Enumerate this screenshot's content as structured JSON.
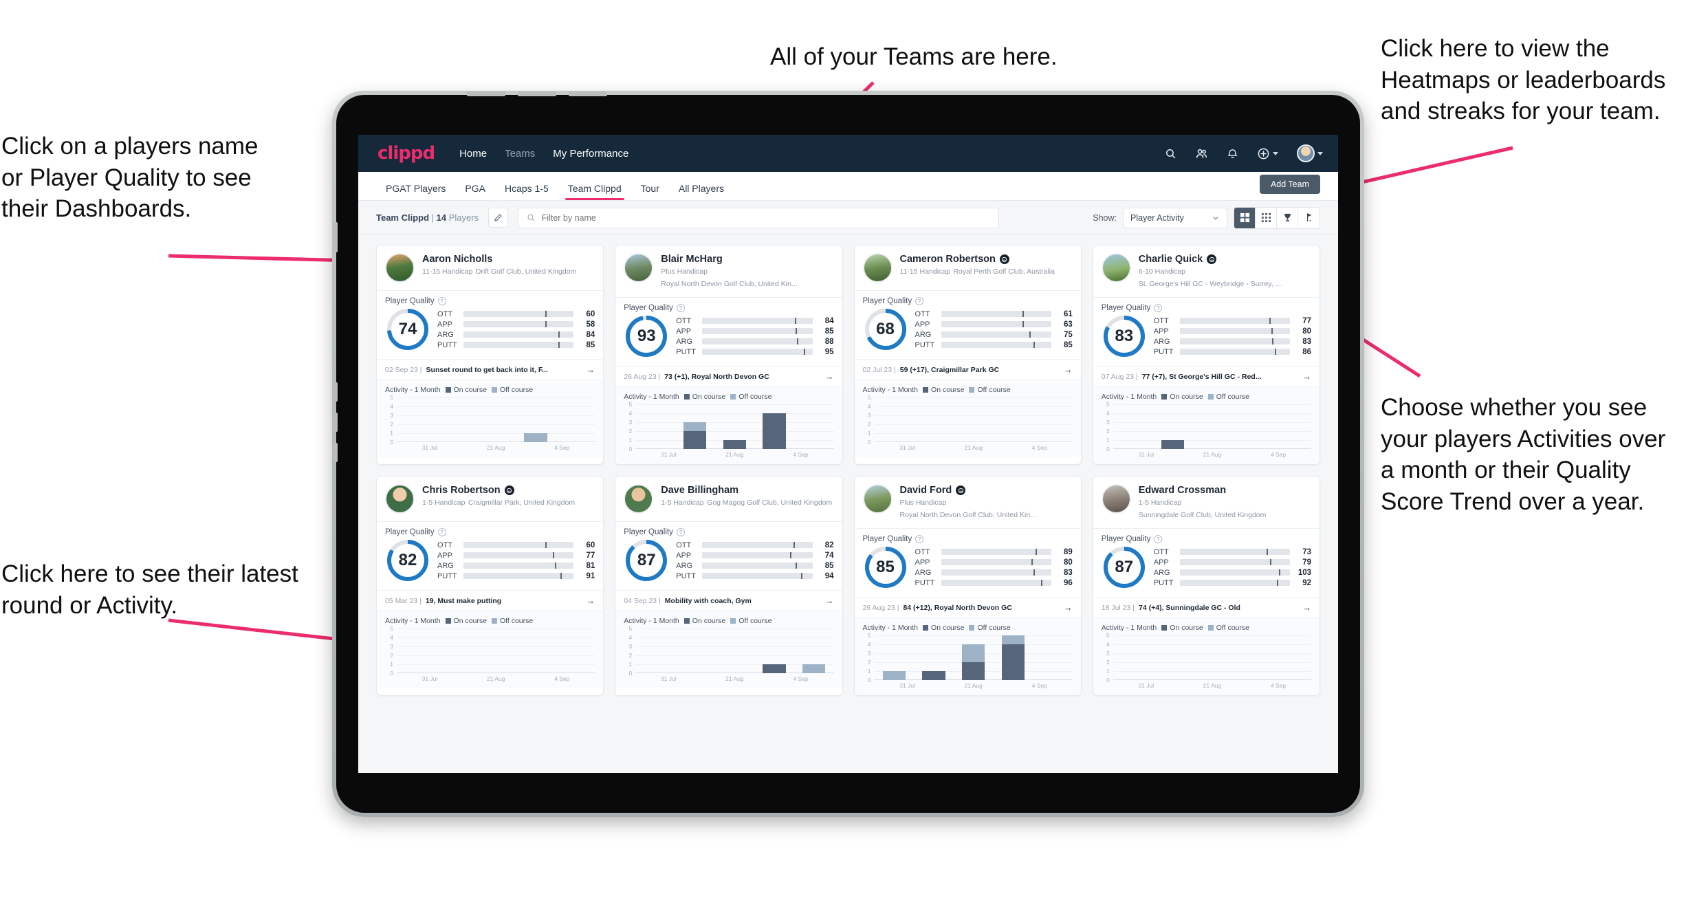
{
  "annotations": {
    "left_top": "Click on a players name\nor Player Quality to see\ntheir Dashboards.",
    "left_bottom": "Click here to see their latest\nround or Activity.",
    "top": "All of your Teams are here.",
    "right_top": "Click here to view the\nHeatmaps or leaderboards\nand streaks for your team.",
    "right_bottom": "Choose whether you see\nyour players Activities over\na month or their Quality\nScore Trend over a year."
  },
  "colors": {
    "brand_pink": "#ec2d6b",
    "navbar": "#15293b",
    "ott": "#f5a800",
    "app": "#3ad7b0",
    "arg": "#f4136b",
    "putt": "#b014c4",
    "donut": "#1e7ac4",
    "on_course": "#56657a",
    "off_course": "#9db2c6"
  },
  "navbar": {
    "logo": "clippd",
    "links": [
      {
        "label": "Home",
        "active": true
      },
      {
        "label": "Teams",
        "active": false
      },
      {
        "label": "My Performance",
        "active": true
      }
    ],
    "icons": [
      "search-icon",
      "people-icon",
      "bell-icon",
      "plus-circle-icon",
      "avatar"
    ]
  },
  "tabs": [
    {
      "label": "PGAT Players",
      "active": false
    },
    {
      "label": "PGA",
      "active": false
    },
    {
      "label": "Hcaps 1-5",
      "active": false
    },
    {
      "label": "Team Clippd",
      "active": true
    },
    {
      "label": "Tour",
      "active": false
    },
    {
      "label": "All Players",
      "active": false
    }
  ],
  "add_team_label": "Add Team",
  "toolbar": {
    "team_name": "Team Clippd",
    "team_separator": " | ",
    "team_count": "14",
    "team_count_suffix": " Players",
    "edit_icon": "pencil-icon",
    "search_placeholder": "Filter by name",
    "show_label": "Show:",
    "show_value": "Player Activity",
    "show_options": [
      "Player Activity",
      "Quality Score Trend"
    ],
    "view_toggles": [
      {
        "name": "grid-large-icon",
        "active": true
      },
      {
        "name": "grid-small-icon",
        "active": false
      },
      {
        "name": "trophy-icon",
        "active": false
      },
      {
        "name": "golf-flag-icon",
        "active": false
      }
    ]
  },
  "card_labels": {
    "player_quality": "Player Quality",
    "activity_title": "Activity - 1 Month",
    "legend_on": "On course",
    "legend_off": "Off course",
    "metric_names": [
      "OTT",
      "APP",
      "ARG",
      "PUTT"
    ]
  },
  "chart_data": {
    "type": "bar",
    "title": "Activity - 1 Month",
    "categories": [
      "31 Jul",
      "",
      "21 Aug",
      "4 Sep"
    ],
    "xlabels": [
      "31 Jul",
      "21 Aug",
      "4 Sep"
    ],
    "ylim": [
      0,
      5
    ],
    "yticks": [
      0,
      1,
      2,
      3,
      4,
      5
    ],
    "ylabel": "",
    "xlabel": "",
    "grid": true,
    "legend": [
      "On course",
      "Off course"
    ],
    "stacked": true,
    "series_per_player": true
  },
  "players": [
    {
      "name": "Aaron Nicholls",
      "verified": false,
      "handicap": "11-15 Handicap",
      "club": "Drift Golf Club, United Kingdom",
      "score": "74",
      "score_pct": 74,
      "metrics": [
        {
          "label": "OTT",
          "value": "60",
          "pct": 56,
          "tick": 74
        },
        {
          "label": "APP",
          "value": "58",
          "pct": 54,
          "tick": 74
        },
        {
          "label": "ARG",
          "value": "84",
          "pct": 79,
          "tick": 86
        },
        {
          "label": "PUTT",
          "value": "85",
          "pct": 80,
          "tick": 86
        }
      ],
      "round_date": "02 Sep 23",
      "round_text": "Sunset round to get back into it, F...",
      "activity": [
        {
          "on": 0,
          "off": 0
        },
        {
          "on": 0,
          "off": 0
        },
        {
          "on": 0,
          "off": 0
        },
        {
          "on": 0,
          "off": 1
        },
        {
          "on": 0,
          "off": 0
        }
      ]
    },
    {
      "name": "Blair McHarg",
      "verified": false,
      "handicap": "Plus Handicap",
      "club": "Royal North Devon Golf Club, United Kin...",
      "score": "93",
      "score_pct": 97,
      "metrics": [
        {
          "label": "OTT",
          "value": "84",
          "pct": 77,
          "tick": 84
        },
        {
          "label": "APP",
          "value": "85",
          "pct": 78,
          "tick": 85
        },
        {
          "label": "ARG",
          "value": "88",
          "pct": 80,
          "tick": 86
        },
        {
          "label": "PUTT",
          "value": "95",
          "pct": 88,
          "tick": 92
        }
      ],
      "round_date": "26 Aug 23",
      "round_text": "73 (+1), Royal North Devon GC",
      "activity": [
        {
          "on": 0,
          "off": 0
        },
        {
          "on": 2,
          "off": 1
        },
        {
          "on": 1,
          "off": 0
        },
        {
          "on": 4,
          "off": 0
        },
        {
          "on": 0,
          "off": 0
        }
      ]
    },
    {
      "name": "Cameron Robertson",
      "verified": true,
      "handicap": "11-15 Handicap",
      "club": "Royal Perth Golf Club, Australia",
      "score": "68",
      "score_pct": 68,
      "metrics": [
        {
          "label": "OTT",
          "value": "61",
          "pct": 56,
          "tick": 74
        },
        {
          "label": "APP",
          "value": "63",
          "pct": 54,
          "tick": 74
        },
        {
          "label": "ARG",
          "value": "75",
          "pct": 70,
          "tick": 80
        },
        {
          "label": "PUTT",
          "value": "85",
          "pct": 77,
          "tick": 84
        }
      ],
      "round_date": "02 Jul 23",
      "round_text": "59 (+17), Craigmillar Park GC",
      "activity": [
        {
          "on": 0,
          "off": 0
        },
        {
          "on": 0,
          "off": 0
        },
        {
          "on": 0,
          "off": 0
        },
        {
          "on": 0,
          "off": 0
        },
        {
          "on": 0,
          "off": 0
        }
      ]
    },
    {
      "name": "Charlie Quick",
      "verified": true,
      "handicap": "6-10 Handicap",
      "club": "St. George's Hill GC - Weybridge - Surrey, ...",
      "score": "83",
      "score_pct": 83,
      "metrics": [
        {
          "label": "OTT",
          "value": "77",
          "pct": 72,
          "tick": 81
        },
        {
          "label": "APP",
          "value": "80",
          "pct": 75,
          "tick": 83
        },
        {
          "label": "ARG",
          "value": "83",
          "pct": 77,
          "tick": 84
        },
        {
          "label": "PUTT",
          "value": "86",
          "pct": 79,
          "tick": 86
        }
      ],
      "round_date": "07 Aug 23",
      "round_text": "77 (+7), St George's Hill GC - Red...",
      "activity": [
        {
          "on": 0,
          "off": 0
        },
        {
          "on": 1,
          "off": 0
        },
        {
          "on": 0,
          "off": 0
        },
        {
          "on": 0,
          "off": 0
        },
        {
          "on": 0,
          "off": 0
        }
      ]
    },
    {
      "name": "Chris Robertson",
      "verified": true,
      "handicap": "1-5 Handicap",
      "club": "Craigmillar Park, United Kingdom",
      "score": "82",
      "score_pct": 84,
      "metrics": [
        {
          "label": "OTT",
          "value": "60",
          "pct": 56,
          "tick": 74
        },
        {
          "label": "APP",
          "value": "77",
          "pct": 72,
          "tick": 81
        },
        {
          "label": "ARG",
          "value": "81",
          "pct": 75,
          "tick": 83
        },
        {
          "label": "PUTT",
          "value": "91",
          "pct": 84,
          "tick": 88
        }
      ],
      "round_date": "05 Mar 23",
      "round_text": "19, Must make putting",
      "activity": [
        {
          "on": 0,
          "off": 0
        },
        {
          "on": 0,
          "off": 0
        },
        {
          "on": 0,
          "off": 0
        },
        {
          "on": 0,
          "off": 0
        },
        {
          "on": 0,
          "off": 0
        }
      ]
    },
    {
      "name": "Dave Billingham",
      "verified": false,
      "handicap": "1-5 Handicap",
      "club": "Gog Magog Golf Club, United Kingdom",
      "score": "87",
      "score_pct": 88,
      "metrics": [
        {
          "label": "OTT",
          "value": "82",
          "pct": 76,
          "tick": 83
        },
        {
          "label": "APP",
          "value": "74",
          "pct": 69,
          "tick": 80
        },
        {
          "label": "ARG",
          "value": "85",
          "pct": 78,
          "tick": 85
        },
        {
          "label": "PUTT",
          "value": "94",
          "pct": 86,
          "tick": 90
        }
      ],
      "round_date": "04 Sep 23",
      "round_text": "Mobility with coach, Gym",
      "activity": [
        {
          "on": 0,
          "off": 0
        },
        {
          "on": 0,
          "off": 0
        },
        {
          "on": 0,
          "off": 0
        },
        {
          "on": 1,
          "off": 0
        },
        {
          "on": 0,
          "off": 1
        }
      ]
    },
    {
      "name": "David Ford",
      "verified": true,
      "handicap": "Plus Handicap",
      "club": "Royal North Devon Golf Club, United Kin...",
      "score": "85",
      "score_pct": 86,
      "metrics": [
        {
          "label": "OTT",
          "value": "89",
          "pct": 80,
          "tick": 86
        },
        {
          "label": "APP",
          "value": "80",
          "pct": 74,
          "tick": 82
        },
        {
          "label": "ARG",
          "value": "83",
          "pct": 76,
          "tick": 84
        },
        {
          "label": "PUTT",
          "value": "96",
          "pct": 88,
          "tick": 91
        }
      ],
      "round_date": "26 Aug 23",
      "round_text": "84 (+12), Royal North Devon GC",
      "activity": [
        {
          "on": 0,
          "off": 1
        },
        {
          "on": 1,
          "off": 0
        },
        {
          "on": 2,
          "off": 2
        },
        {
          "on": 4,
          "off": 1
        },
        {
          "on": 0,
          "off": 0
        }
      ]
    },
    {
      "name": "Edward Crossman",
      "verified": false,
      "handicap": "1-5 Handicap",
      "club": "Sunningdale Golf Club, United Kingdom",
      "score": "87",
      "score_pct": 88,
      "metrics": [
        {
          "label": "OTT",
          "value": "73",
          "pct": 66,
          "tick": 79
        },
        {
          "label": "APP",
          "value": "79",
          "pct": 72,
          "tick": 82
        },
        {
          "label": "ARG",
          "value": "103",
          "pct": 85,
          "tick": 90
        },
        {
          "label": "PUTT",
          "value": "92",
          "pct": 84,
          "tick": 88
        }
      ],
      "round_date": "18 Jul 23",
      "round_text": "74 (+4), Sunningdale GC - Old",
      "activity": [
        {
          "on": 0,
          "off": 0
        },
        {
          "on": 0,
          "off": 0
        },
        {
          "on": 0,
          "off": 0
        },
        {
          "on": 0,
          "off": 0
        },
        {
          "on": 0,
          "off": 0
        }
      ]
    }
  ]
}
